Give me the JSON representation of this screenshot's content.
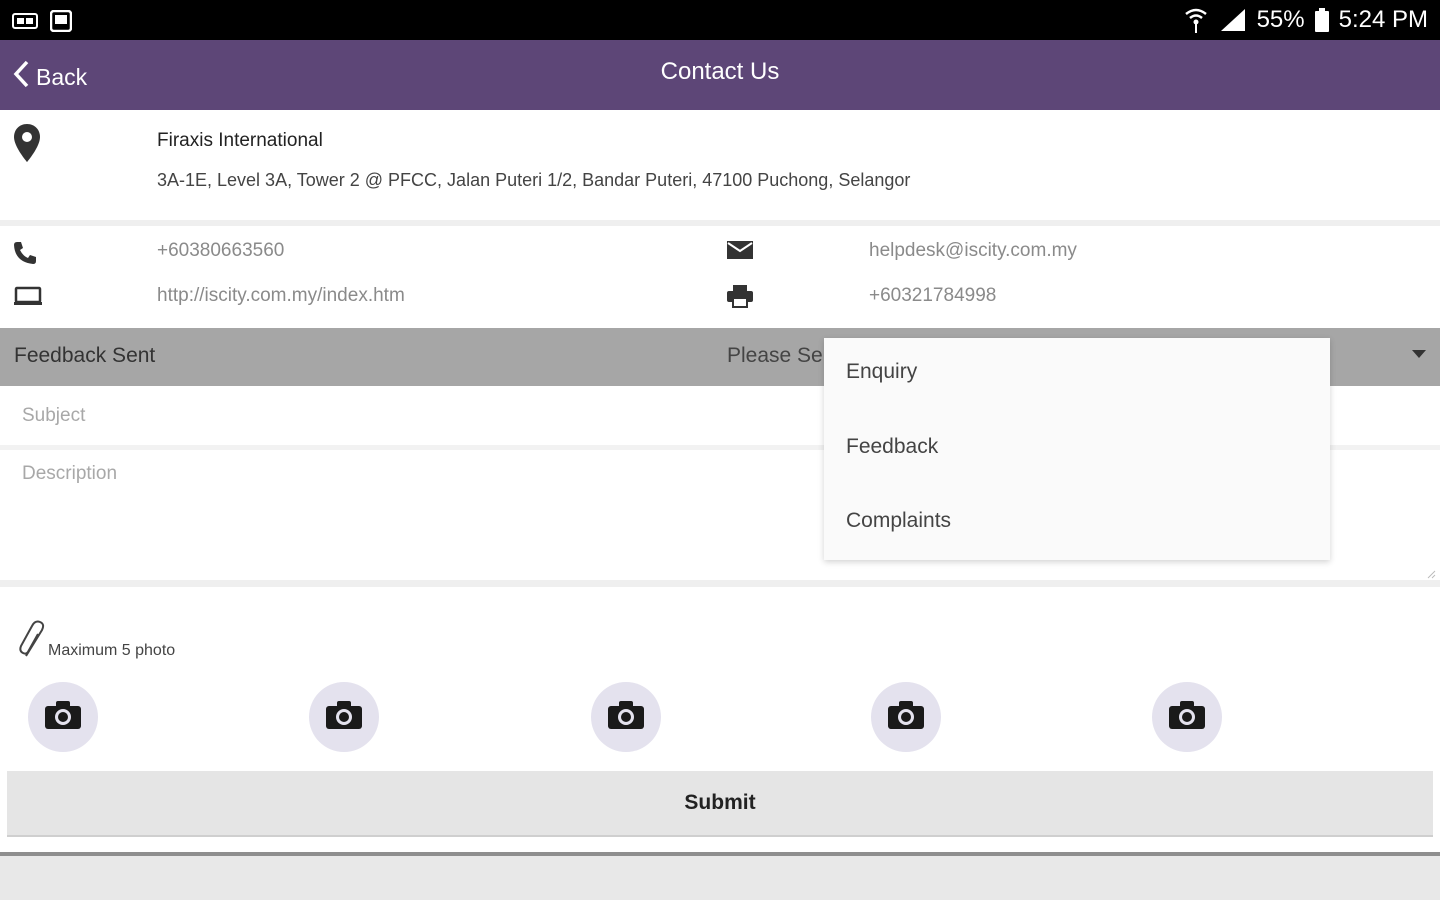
{
  "status_bar": {
    "battery": "55%",
    "time": "5:24 PM"
  },
  "app_bar": {
    "back_label": "Back",
    "title": "Contact Us"
  },
  "address": {
    "company": "Firaxis International",
    "street": "3A-1E, Level 3A, Tower 2 @ PFCC, Jalan Puteri 1/2, Bandar Puteri, 47100 Puchong, Selangor"
  },
  "contact": {
    "phone": "+60380663560",
    "email": "helpdesk@iscity.com.my",
    "website": "http://iscity.com.my/index.htm",
    "fax": "+60321784998"
  },
  "feedback": {
    "title": "Feedback Sent",
    "select_placeholder": "Please Select",
    "options": [
      "Enquiry",
      "Feedback",
      "Complaints"
    ]
  },
  "form": {
    "subject_placeholder": "Subject",
    "description_placeholder": "Description"
  },
  "attachments": {
    "label": "Maximum 5 photo"
  },
  "submit_label": "Submit",
  "colors": {
    "app_bar": "#5d4677",
    "feedback_bar": "#a6a6a6",
    "camera_bg": "#e4e2ee"
  }
}
